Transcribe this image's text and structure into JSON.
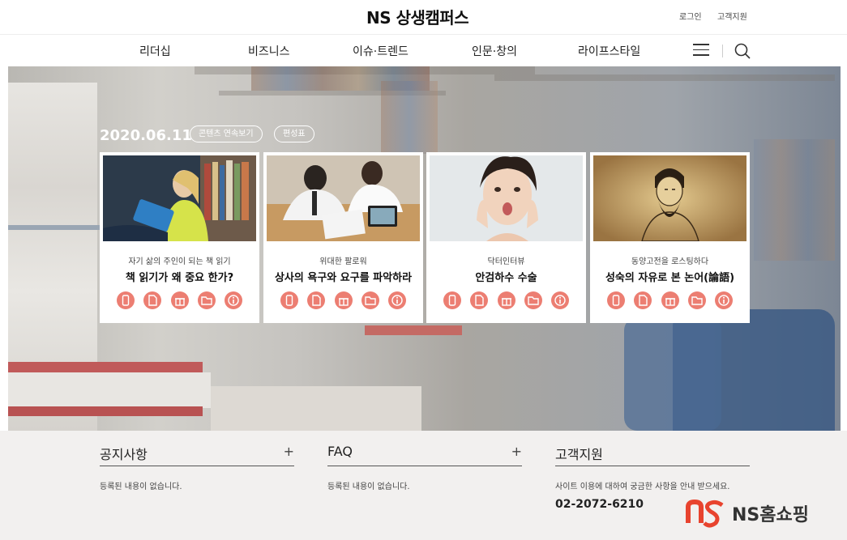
{
  "header": {
    "logo": "NS 상생캠퍼스",
    "login": "로그인",
    "support": "고객지원",
    "nav": [
      "리더십",
      "비즈니스",
      "이슈·트렌드",
      "인문·창의",
      "라이프스타일"
    ]
  },
  "hero": {
    "date": "2020.06.11",
    "continuous_btn": "콘텐츠 연속보기",
    "schedule_btn": "편성표"
  },
  "cards": [
    {
      "subtitle": "자기 삶의 주인이 되는 책 읽기",
      "title": "책 읽기가 왜 중요 한가?"
    },
    {
      "subtitle": "위대한 팔로워",
      "title": "상사의 욕구와 요구를 파악하라"
    },
    {
      "subtitle": "닥터인터뷰",
      "title": "안검하수 수술"
    },
    {
      "subtitle": "동양고전을 로스팅하다",
      "title": "성숙의 자유로 본 논어(論語)"
    }
  ],
  "card_icons": [
    "mobile-icon",
    "document-icon",
    "gift-icon",
    "folder-icon",
    "info-icon"
  ],
  "footer": {
    "notice": {
      "title": "공지사항",
      "plus": "+",
      "body": "등록된 내용이 없습니다."
    },
    "faq": {
      "title": "FAQ",
      "plus": "+",
      "body": "등록된 내용이 없습니다."
    },
    "support": {
      "title": "고객지원",
      "body": "사이트 이용에 대하여 궁금한 사항을 안내 받으세요.",
      "phone": "02-2072-6210"
    }
  },
  "brand": {
    "name": "NS홈쇼핑"
  },
  "colors": {
    "accent": "#ec7e72",
    "brand_red": "#e8432e"
  }
}
